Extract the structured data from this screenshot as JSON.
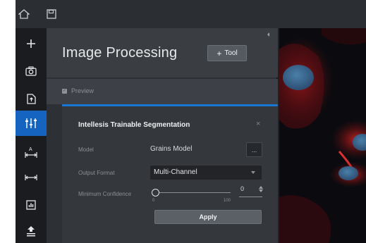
{
  "topbar": {
    "home_icon": "home-icon",
    "save_icon": "save-icon"
  },
  "toolbar": {
    "items": [
      {
        "name": "add-tool",
        "icon": "plus-icon"
      },
      {
        "name": "camera",
        "icon": "camera-icon"
      },
      {
        "name": "import",
        "icon": "file-import-icon"
      },
      {
        "name": "processing",
        "icon": "processing-sliders-icon",
        "active": true
      },
      {
        "name": "scale-text",
        "icon": "scale-text-icon"
      },
      {
        "name": "measure",
        "icon": "measure-icon"
      },
      {
        "name": "chart",
        "icon": "bar-chart-icon"
      },
      {
        "name": "export",
        "icon": "export-icon"
      }
    ],
    "scale_letter": "A"
  },
  "panel": {
    "title": "Image Processing",
    "add_tool_label": "Tool",
    "add_tool_glyph": "+",
    "preview_label": "Preview",
    "preview_checked": true
  },
  "card": {
    "title": "Intellesis Trainable Segmentation",
    "close_glyph": "×",
    "model_label": "Model",
    "model_value": "Grains Model",
    "browse_label": "...",
    "output_label": "Output Format",
    "output_value": "Multi-Channel",
    "confidence_label": "Minimum Confidence",
    "confidence_min": "0",
    "confidence_max": "100",
    "confidence_value": "0",
    "apply_label": "Apply"
  },
  "colors": {
    "accent": "#1976d2",
    "active_tool": "#1565c0",
    "panel_bg": "#2d3035",
    "card_bg": "#34373c"
  }
}
